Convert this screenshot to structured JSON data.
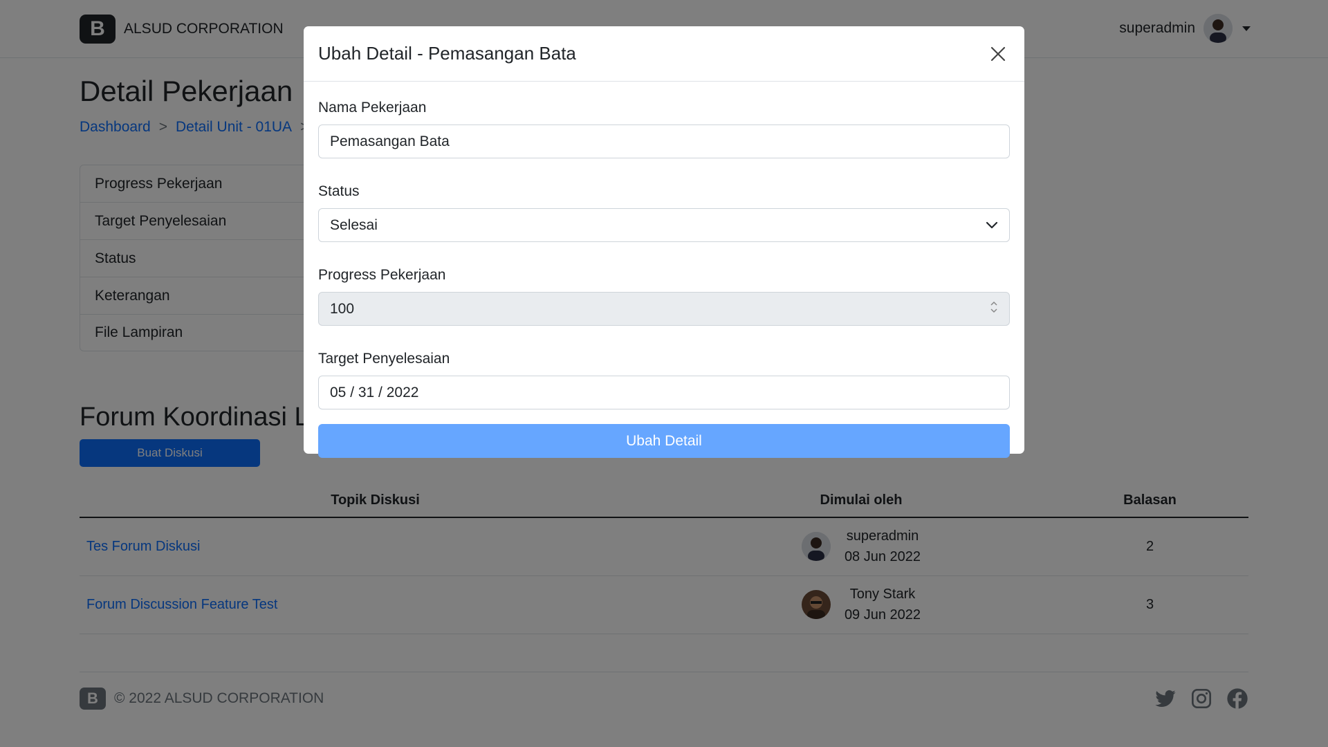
{
  "navbar": {
    "brand_logo": "B",
    "brand_name": "ALSUD CORPORATION",
    "user_name": "superadmin"
  },
  "page": {
    "title": "Detail Pekerjaan",
    "breadcrumb": [
      "Dashboard",
      "Detail Unit - 01UA"
    ],
    "breadcrumb_sep": ">"
  },
  "detail_items": [
    "Progress Pekerjaan",
    "Target Penyelesaian",
    "Status",
    "Keterangan",
    "File Lampiran"
  ],
  "forum": {
    "title": "Forum Koordinasi La",
    "create_button": "Buat Diskusi",
    "headers": {
      "topic": "Topik Diskusi",
      "started_by": "Dimulai oleh",
      "replies": "Balasan"
    },
    "rows": [
      {
        "topic": "Tes Forum Diskusi",
        "user": "superadmin",
        "date": "08 Jun 2022",
        "replies": "2"
      },
      {
        "topic": "Forum Discussion Feature Test",
        "user": "Tony Stark",
        "date": "09 Jun 2022",
        "replies": "3"
      }
    ]
  },
  "footer": {
    "logo": "B",
    "text": "© 2022 ALSUD CORPORATION",
    "icons": [
      "twitter-icon",
      "instagram-icon",
      "facebook-icon"
    ]
  },
  "modal": {
    "title": "Ubah Detail - Pemasangan Bata",
    "name_label": "Nama Pekerjaan",
    "name_value": "Pemasangan Bata",
    "status_label": "Status",
    "status_value": "Selesai",
    "progress_label": "Progress Pekerjaan",
    "progress_value": "100",
    "target_label": "Target Penyelesaian",
    "target_value": "05 / 31 / 2022",
    "submit_label": "Ubah Detail"
  },
  "colors": {
    "primary": "#0d6efd",
    "submit_button": "#66a6ff",
    "backdrop": "rgba(0,0,0,0.5)"
  }
}
